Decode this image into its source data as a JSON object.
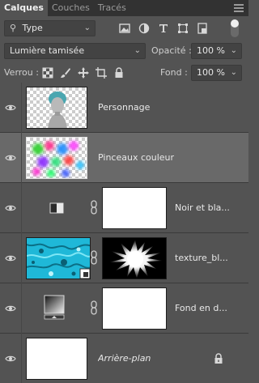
{
  "tabs": [
    {
      "label": "Calques",
      "active": true
    },
    {
      "label": "Couches",
      "active": false
    },
    {
      "label": "Tracés",
      "active": false
    }
  ],
  "filter": {
    "kind_value": "Type",
    "icons": [
      "image-filter-icon",
      "adjustment-filter-icon",
      "type-filter-icon",
      "shape-filter-icon",
      "smart-object-filter-icon"
    ]
  },
  "blend": {
    "mode_value": "Lumière tamisée",
    "opacity_label": "Opacité :",
    "opacity_value": "100 %"
  },
  "lock": {
    "label": "Verrou :",
    "fill_label": "Fond :",
    "fill_value": "100 %"
  },
  "layers": [
    {
      "name": "Personnage",
      "type": "pixel",
      "selected": false
    },
    {
      "name": "Pinceaux couleur",
      "type": "pixel",
      "selected": true
    },
    {
      "name": "Noir et bla...",
      "type": "adjustment",
      "selected": false
    },
    {
      "name": "texture_bl...",
      "type": "smart-object",
      "selected": false
    },
    {
      "name": "Fond en d...",
      "type": "fill",
      "selected": false
    },
    {
      "name": "Arrière-plan",
      "type": "background",
      "locked": true,
      "selected": false
    }
  ],
  "colors": {
    "panel_bg": "#535353",
    "selected_bg": "#696969",
    "tab_bar_bg": "#323232",
    "texture_cyan": "#1fb8d8"
  }
}
